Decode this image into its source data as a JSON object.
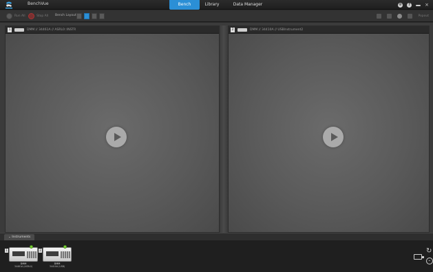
{
  "titlebar": {
    "app_name": "BenchVue",
    "tabs": [
      {
        "label": "Bench",
        "active": true
      },
      {
        "label": "Library",
        "active": false
      },
      {
        "label": "Data Manager",
        "active": false
      }
    ],
    "help_icon": "?",
    "close_glyph": "×"
  },
  "toolbar": {
    "run_label": "Run All",
    "stop_label": "Stop All",
    "layout_label": "Bench Layout:",
    "right_label": "Popout"
  },
  "panels": [
    {
      "number": "1",
      "title": "DMM // 34461A // ASRL0::INSTR"
    },
    {
      "number": "2",
      "title": "DMM // 34410A // USBInstrument2"
    }
  ],
  "instruments_tab": "Instruments",
  "instruments": [
    {
      "number": "1",
      "name": "DMM",
      "address": "34461A (ASRL0)"
    },
    {
      "number": "2",
      "name": "DMM",
      "address": "34410A (USB)"
    }
  ],
  "colors": {
    "accent": "#2b8fd6",
    "status_led": "#7bd23a"
  }
}
